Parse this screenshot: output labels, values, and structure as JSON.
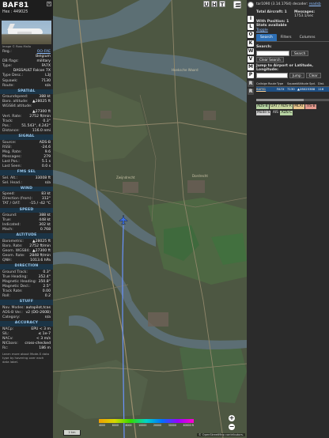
{
  "aircraft": {
    "callsign": "BAF81",
    "hex_label": "Hex : 449025",
    "photo_credit": "Image © Ross Mallo",
    "registration": {
      "label": "Reg.:",
      "value": "OO-FAE"
    },
    "country": {
      "label": "",
      "value": "Belgium"
    },
    "db_flags": {
      "label": "DB flags:",
      "value": "military"
    },
    "type": {
      "label": "Type:",
      "value": "FA7X"
    },
    "type_full": "DASSAULT Falcon 7X",
    "type_desc": {
      "label": "Type Desc.:",
      "value": "L3J"
    },
    "squawk": {
      "label": "Squawk:",
      "value": "7130"
    },
    "route": {
      "label": "Route:",
      "value": "n/a"
    }
  },
  "sections": {
    "spatial": {
      "title": "SPATIAL",
      "rows": [
        {
          "k": "Groundspeed:",
          "v": "388 kt"
        },
        {
          "k": "Baro. altitude:",
          "v": "▲28025 ft"
        },
        {
          "k": "WGS84 altitude:",
          "v": ""
        },
        {
          "k": "",
          "v": "▲27300 ft"
        },
        {
          "k": "Vert. Rate:",
          "v": "2752 ft/min"
        },
        {
          "k": "Track:",
          "v": "0.3°"
        },
        {
          "k": "Pos.:",
          "v": "51.543°, 4.242°"
        },
        {
          "k": "Distance:",
          "v": "116.0 nmi"
        }
      ]
    },
    "signal": {
      "title": "SIGNAL",
      "rows": [
        {
          "k": "Source:",
          "v": "ADS-B"
        },
        {
          "k": "RSSI:",
          "v": "-24.6"
        },
        {
          "k": "Msg. Rate:",
          "v": "9.6"
        },
        {
          "k": "Messages:",
          "v": "279"
        },
        {
          "k": "Last Pos.:",
          "v": "5.1 s"
        },
        {
          "k": "Last Seen:",
          "v": "0.0 s"
        }
      ]
    },
    "fms_sel": {
      "title": "FMS SEL",
      "rows": [
        {
          "k": "Sel. Alt.:",
          "v": "33008 ft"
        },
        {
          "k": "Sel. Head.:",
          "v": "n/a"
        }
      ]
    },
    "wind": {
      "title": "WIND",
      "rows": [
        {
          "k": "Speed:",
          "v": "83 kt"
        },
        {
          "k": "Direction (from):",
          "v": "312°"
        },
        {
          "k": "TAT / OAT:",
          "v": "-15 / -42 °C"
        }
      ]
    },
    "speed": {
      "title": "SPEED",
      "rows": [
        {
          "k": "Ground:",
          "v": "388 kt"
        },
        {
          "k": "True:",
          "v": "448 kt"
        },
        {
          "k": "Indicated:",
          "v": "302 kt"
        },
        {
          "k": "Mach:",
          "v": "0.768"
        }
      ]
    },
    "altitude": {
      "title": "ALTITUDE",
      "rows": [
        {
          "k": "Barometric:",
          "v": "▲28025 ft"
        },
        {
          "k": "Baro. Rate:",
          "v": "2752 ft/min"
        },
        {
          "k": "Geom. WGS84:",
          "v": "▲27300 ft"
        },
        {
          "k": "Geom. Rate:",
          "v": "2848 ft/min"
        },
        {
          "k": "QNH:",
          "v": "1013.6 hPa"
        }
      ]
    },
    "direction": {
      "title": "DIRECTION",
      "rows": [
        {
          "k": "Ground Track:",
          "v": "0.3°"
        },
        {
          "k": "True Heading:",
          "v": "352.4°"
        },
        {
          "k": "Magnetic Heading:",
          "v": "350.8°"
        },
        {
          "k": "Magnetic Decl.:",
          "v": "2.5°"
        },
        {
          "k": "Track Rate:",
          "v": "0.00"
        },
        {
          "k": "Roll:",
          "v": "0.2"
        }
      ]
    },
    "stuff": {
      "title": "STUFF",
      "rows": [
        {
          "k": "Nav. Modes:",
          "v": "autopilot,tcas"
        },
        {
          "k": "ADS-B Ver.:",
          "v": "v2 (DO-260B)"
        },
        {
          "k": "Category:",
          "v": "n/a"
        }
      ]
    },
    "accuracy": {
      "title": "ACCURACY",
      "rows": [
        {
          "k": "NACp:",
          "v": "EPU < 3 m"
        },
        {
          "k": "SIL:",
          "v": "≤ 1e-7"
        },
        {
          "k": "NACv:",
          "v": "< 3 m/s"
        },
        {
          "k": "NICbaro:",
          "v": "cross-checked"
        },
        {
          "k": "Rc:",
          "v": "186 m"
        }
      ]
    }
  },
  "note": "Learn more about Mode-S data type by hovering over each data label.",
  "map": {
    "top_buttons": [
      "U",
      "H",
      "T"
    ],
    "zoom_in": "+",
    "zoom_out": "−",
    "scale_label": "2 km",
    "attribution": "© OpenStreetMap contributors.",
    "altitude_ticks": [
      "4000",
      "6000",
      "8000",
      "10000",
      "20000",
      "30000",
      "40000 ft"
    ],
    "place_labels": [
      "Hoeksche Waard",
      "Dordrecht",
      "Zwijndrecht"
    ],
    "aircraft_symbol_color": "#3b6ee8",
    "track_color": "#6a93ff"
  },
  "sidebar": {
    "buttons": [
      "I",
      "L",
      "O",
      "K",
      "W",
      "V",
      "M",
      "P",
      "R",
      "R"
    ],
    "title_prefix": "tar1090",
    "title_version": "(3.14.1764)",
    "title_suffix": "decoder:",
    "title_link": "readsb",
    "total_aircraft": "Total Aircraft: 1",
    "messages_label": "Messages:",
    "messages_value": "1753.1/sec",
    "with_position": "With Position: 1",
    "stats_available": "Stats available",
    "toggle": "Toggle",
    "tabs": [
      "Search",
      "Filters",
      "Columns"
    ],
    "search_label": "Search:",
    "search_button": "Search",
    "clear_search": "Clear Search",
    "jump_label": "Jump to Airport or Latitude, Longitude:",
    "jump_button": "Jump",
    "clear_button": "Clear",
    "columns": [
      "Callsign",
      "Route",
      "Type",
      "Squawk",
      "Altitude",
      "Spd.",
      "Dist."
    ],
    "rows": [
      {
        "callsign": "BAF81",
        "route": "",
        "type": "FA7X",
        "squawk": "7130",
        "altitude": "▲28025",
        "speed": "388",
        "distance": "116"
      }
    ],
    "legend": [
      {
        "label": "ADS-B",
        "color": "#b7d4a3"
      },
      {
        "label": "UAT / ADS-R",
        "color": "#c9d6a0"
      },
      {
        "label": "MLAT",
        "color": "#eac78e"
      },
      {
        "label": "TIS-B",
        "color": "#e59b8f"
      },
      {
        "label": "Mode-S",
        "color": "#cfcfcf"
      },
      {
        "label": "AIS",
        "color": "#2b2b2b"
      },
      {
        "label": "ADS-C",
        "color": "#b7d4a3"
      }
    ]
  },
  "colors": {
    "panel_bg": "#252525",
    "section_header_bg": "#1b3446",
    "section_header_text": "#9ecbef",
    "active_tab": "#2d6fb5",
    "selected_row": "#1e4f83"
  }
}
